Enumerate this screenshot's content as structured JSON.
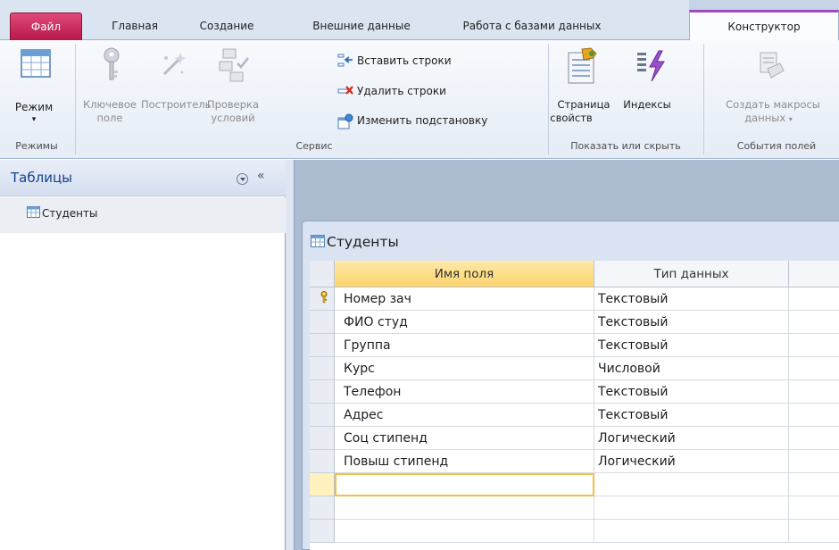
{
  "tabs": {
    "file": "Файл",
    "home": "Главная",
    "create": "Создание",
    "external": "Внешние данные",
    "dbtools": "Работа с базами данных",
    "constructor": "Конструктор"
  },
  "ribbon": {
    "groups": {
      "modes": "Режимы",
      "service": "Сервис",
      "showhide": "Показать или скрыть",
      "fieldevents": "События полей"
    },
    "buttons": {
      "mode": "Режим",
      "key_field_1": "Ключевое",
      "key_field_2": "поле",
      "builder": "Построитель",
      "check_1": "Проверка",
      "check_2": "условий",
      "insert_rows": "Вставить строки",
      "delete_rows": "Удалить строки",
      "modify_lookups": "Изменить подстановку",
      "property_sheet_1": "Страница",
      "property_sheet_2": "свойств",
      "indexes": "Индексы",
      "create_macros_1": "Создать макросы",
      "create_macros_2": "данных"
    }
  },
  "nav": {
    "title": "Таблицы",
    "collapse": "«",
    "items": [
      {
        "label": "Студенты"
      }
    ]
  },
  "document": {
    "title": "Студенты",
    "columns": {
      "name": "Имя поля",
      "type": "Тип данных"
    },
    "rows": [
      {
        "name": "Номер зач",
        "type": "Текстовый",
        "key": true
      },
      {
        "name": "ФИО студ",
        "type": "Текстовый"
      },
      {
        "name": "Группа",
        "type": "Текстовый"
      },
      {
        "name": "Курс",
        "type": "Числовой"
      },
      {
        "name": "Телефон",
        "type": "Текстовый"
      },
      {
        "name": "Адрес",
        "type": "Текстовый"
      },
      {
        "name": "Соц стипенд",
        "type": "Логический"
      },
      {
        "name": "Повыш стипенд",
        "type": "Логический"
      },
      {
        "name": "",
        "type": ""
      },
      {
        "name": "",
        "type": ""
      },
      {
        "name": "",
        "type": ""
      }
    ]
  },
  "colors": {
    "file_tab": "#c72e5e",
    "constructor_accent": "#9e4bbf",
    "header_highlight": "#fbd46e",
    "nav_title": "#15428b"
  },
  "icons": [
    "key-icon",
    "builder-wand-icon",
    "check-conditions-icon",
    "insert-rows-icon",
    "delete-rows-icon",
    "modify-lookups-icon",
    "property-sheet-icon",
    "indexes-icon",
    "macros-icon",
    "table-icon",
    "mode-view-icon"
  ]
}
